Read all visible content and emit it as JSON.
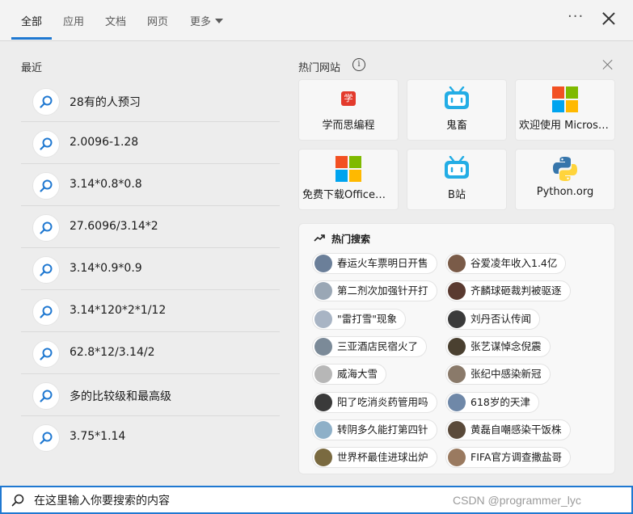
{
  "tabs": [
    {
      "label": "全部"
    },
    {
      "label": "应用"
    },
    {
      "label": "文档"
    },
    {
      "label": "网页"
    },
    {
      "label": "更多"
    }
  ],
  "more_label": "···",
  "recent": {
    "title": "最近",
    "items": [
      "28有的人预习",
      "2.0096-1.28",
      "3.14*0.8*0.8",
      "27.6096/3.14*2",
      "3.14*0.9*0.9",
      "3.14*120*2*1/12",
      "62.8*12/3.14/2",
      "多的比较级和最高级",
      "3.75*1.14"
    ]
  },
  "hot_sites": {
    "title": "热门网站",
    "tiles": [
      {
        "label": "学而思编程",
        "icon": "xue-icon",
        "icon_text": "学"
      },
      {
        "label": "鬼畜",
        "icon": "bilibili-icon"
      },
      {
        "label": "欢迎使用 Microsoft Edge",
        "icon": "microsoft-icon"
      },
      {
        "label": "免费下载Office应用",
        "icon": "microsoft-icon"
      },
      {
        "label": "B站",
        "icon": "bilibili-icon"
      },
      {
        "label": "Python.org",
        "icon": "python-icon"
      }
    ]
  },
  "hot_search": {
    "title": "热门搜索",
    "items": [
      "春运火车票明日开售",
      "谷爱凌年收入1.4亿",
      "第二剂次加强针开打",
      "齐麟球砸裁判被驱逐",
      "\"雷打雪\"现象",
      "刘丹否认传闻",
      "三亚酒店民宿火了",
      "张艺谋悼念倪震",
      "威海大雪",
      "张纪中感染新冠",
      "阳了吃消炎药管用吗",
      "618岁的天津",
      "转阴多久能打第四针",
      "黄磊自嘲感染干饭株",
      "世界杯最佳进球出炉",
      "FIFA官方调查撒盐哥"
    ]
  },
  "search": {
    "placeholder": "在这里输入你要搜索的内容"
  },
  "watermark": "CSDN @programmer_lyc",
  "colors": {
    "accent": "#1f78d1",
    "bilibili": "#23ade5",
    "xue": "#e33a2c"
  }
}
